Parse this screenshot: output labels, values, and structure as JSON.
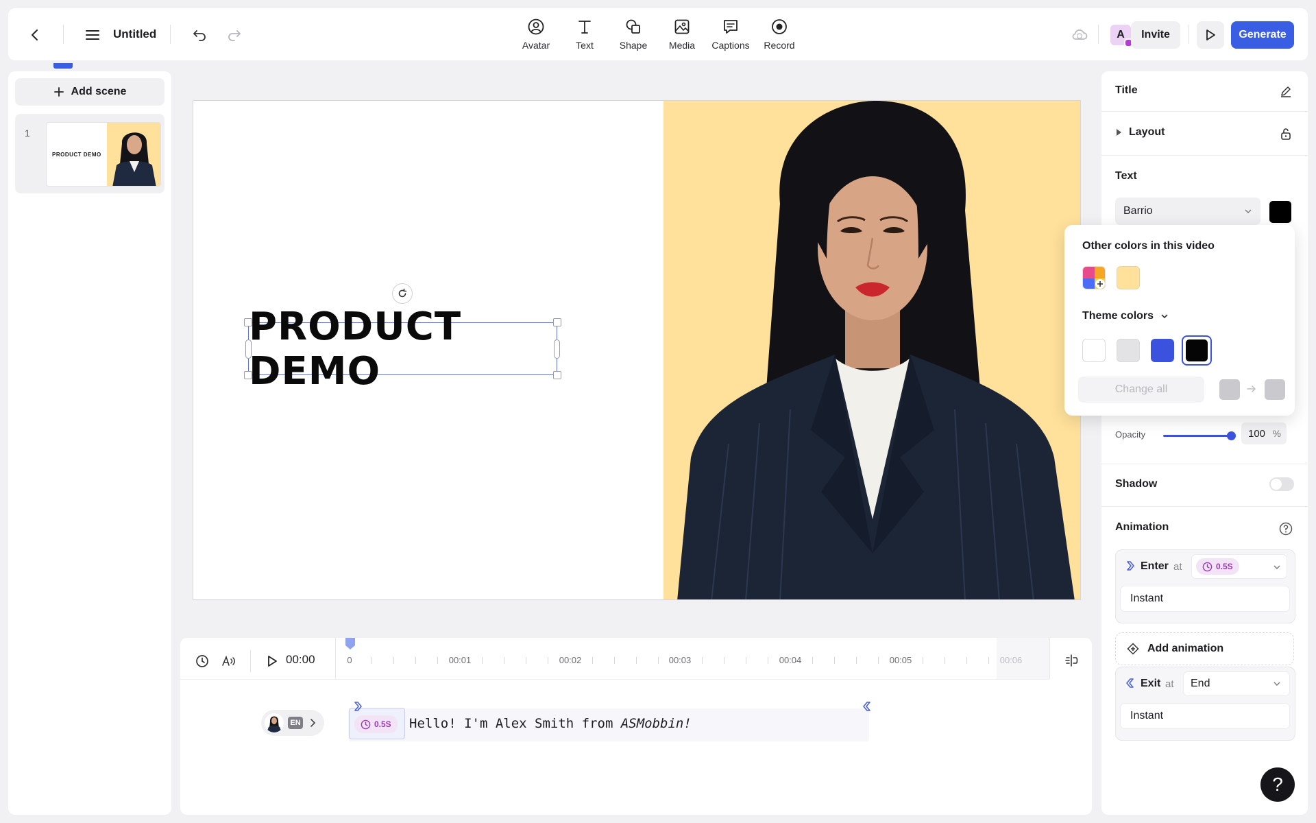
{
  "header": {
    "title": "Untitled",
    "tools": [
      {
        "label": "Avatar",
        "icon": "avatar-icon"
      },
      {
        "label": "Text",
        "icon": "text-icon"
      },
      {
        "label": "Shape",
        "icon": "shape-icon"
      },
      {
        "label": "Media",
        "icon": "media-icon"
      },
      {
        "label": "Captions",
        "icon": "captions-icon"
      },
      {
        "label": "Record",
        "icon": "record-icon"
      }
    ],
    "user_initial": "A",
    "invite_label": "Invite",
    "generate_label": "Generate"
  },
  "sidebar": {
    "add_scene_label": "Add scene",
    "scenes": [
      {
        "number": "1",
        "thumb_text": "PRODUCT DEMO"
      }
    ]
  },
  "canvas": {
    "heading_text": "PRODUCT DEMO",
    "background_color": "#ffe19b"
  },
  "timeline": {
    "current_time": "00:00",
    "ticks": [
      "0",
      "00:01",
      "00:02",
      "00:03",
      "00:04",
      "00:05",
      "00:06"
    ],
    "script": {
      "language": "EN",
      "delay": "0.5S",
      "text_plain": "Hello! I'm Alex Smith from ",
      "text_italic": "ASMobbin!"
    }
  },
  "panel": {
    "title_label": "Title",
    "layout_label": "Layout",
    "text_label": "Text",
    "font_value": "Barrio",
    "opacity_label": "Opacity",
    "opacity_value": "100",
    "opacity_unit": "%",
    "opacity_fraction": 1.0,
    "shadow_label": "Shadow",
    "animation_label": "Animation",
    "enter_label": "Enter",
    "at_label": "at",
    "enter_delay": "0.5S",
    "enter_type": "Instant",
    "add_animation_label": "Add animation",
    "exit_label": "Exit",
    "exit_at_value": "End",
    "exit_type": "Instant"
  },
  "color_popup": {
    "other_colors_label": "Other colors in this video",
    "other_colors": [
      "#ffe19b"
    ],
    "theme_colors_label": "Theme colors",
    "theme_colors": [
      "#ffffff",
      "#e3e3e6",
      "#3a52dd",
      "#050505"
    ],
    "change_all_label": "Change all"
  },
  "colors": {
    "accent": "#3a5ee3",
    "text_color_swatch": "#000000"
  }
}
